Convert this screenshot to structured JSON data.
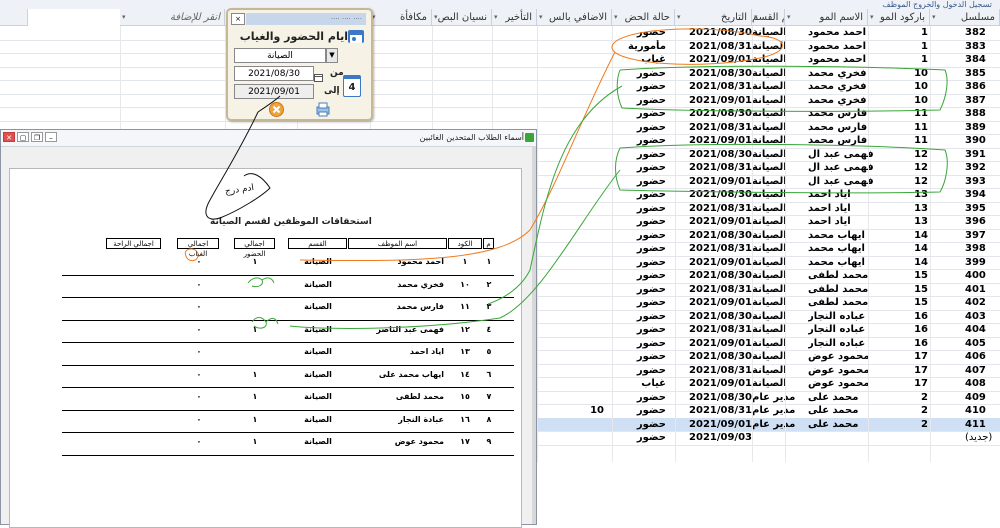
{
  "window_title": "تسجيل الدخول والخروج الموظف",
  "columns": [
    {
      "label": "مسلسل",
      "sort": true
    },
    {
      "label": "باركود المو",
      "sort": true
    },
    {
      "label": "الاسم المو",
      "sort": true
    },
    {
      "label": "اسم القسم",
      "sort": true
    },
    {
      "label": "التاريخ",
      "sort": true
    },
    {
      "label": "حالة الحض",
      "sort": true
    },
    {
      "label": "الاضافي بالس",
      "sort": true
    },
    {
      "label": "التأخير",
      "sort": true
    },
    {
      "label": "نسيان البص",
      "sort": true
    },
    {
      "label": "مكافأة",
      "sort": true
    },
    {
      "label": "وقت الدخ",
      "sort": true
    },
    {
      "label": "وقت الخرو",
      "sort": true
    },
    {
      "label": "انقر للإضافة",
      "sort": true
    }
  ],
  "rows": [
    {
      "id": "382",
      "code": "1",
      "name": "احمد محمود",
      "dept": "الصيانة",
      "date": "2021/08/30",
      "status": "حضور",
      "extra": ""
    },
    {
      "id": "383",
      "code": "1",
      "name": "احمد محمود",
      "dept": "الصيانة",
      "date": "2021/08/31",
      "status": "مأمورية",
      "extra": ""
    },
    {
      "id": "384",
      "code": "1",
      "name": "احمد محمود",
      "dept": "الصيانة",
      "date": "2021/09/01",
      "status": "غياب",
      "extra": ""
    },
    {
      "id": "385",
      "code": "10",
      "name": "فخري محمد",
      "dept": "الصيانة",
      "date": "2021/08/30",
      "status": "حضور",
      "extra": ""
    },
    {
      "id": "386",
      "code": "10",
      "name": "فخري محمد",
      "dept": "الصيانة",
      "date": "2021/08/31",
      "status": "حضور",
      "extra": ""
    },
    {
      "id": "387",
      "code": "10",
      "name": "فخري محمد",
      "dept": "الصيانة",
      "date": "2021/09/01",
      "status": "حضور",
      "extra": ""
    },
    {
      "id": "388",
      "code": "11",
      "name": "فارس محمد",
      "dept": "الصيانة",
      "date": "2021/08/30",
      "status": "حضور",
      "extra": ""
    },
    {
      "id": "389",
      "code": "11",
      "name": "فارس محمد",
      "dept": "الصيانة",
      "date": "2021/08/31",
      "status": "حضور",
      "extra": ""
    },
    {
      "id": "390",
      "code": "11",
      "name": "فارس محمد",
      "dept": "الصيانة",
      "date": "2021/09/01",
      "status": "حضور",
      "extra": ""
    },
    {
      "id": "391",
      "code": "12",
      "name": "فهمى عبد ال",
      "dept": "الصيانة",
      "date": "2021/08/30",
      "status": "حضور",
      "extra": ""
    },
    {
      "id": "392",
      "code": "12",
      "name": "فهمى عبد ال",
      "dept": "الصيانة",
      "date": "2021/08/31",
      "status": "حضور",
      "extra": ""
    },
    {
      "id": "393",
      "code": "12",
      "name": "فهمى عبد ال",
      "dept": "الصيانة",
      "date": "2021/09/01",
      "status": "حضور",
      "extra": ""
    },
    {
      "id": "394",
      "code": "13",
      "name": "اياد احمد",
      "dept": "الصيانة",
      "date": "2021/08/30",
      "status": "حضور",
      "extra": ""
    },
    {
      "id": "395",
      "code": "13",
      "name": "اياد احمد",
      "dept": "الصيانة",
      "date": "2021/08/31",
      "status": "حضور",
      "extra": ""
    },
    {
      "id": "396",
      "code": "13",
      "name": "اياد احمد",
      "dept": "الصيانة",
      "date": "2021/09/01",
      "status": "حضور",
      "extra": ""
    },
    {
      "id": "397",
      "code": "14",
      "name": "ايهاب محمد",
      "dept": "الصيانة",
      "date": "2021/08/30",
      "status": "حضور",
      "extra": ""
    },
    {
      "id": "398",
      "code": "14",
      "name": "ايهاب محمد",
      "dept": "الصيانة",
      "date": "2021/08/31",
      "status": "حضور",
      "extra": ""
    },
    {
      "id": "399",
      "code": "14",
      "name": "ايهاب محمد",
      "dept": "الصيانة",
      "date": "2021/09/01",
      "status": "حضور",
      "extra": ""
    },
    {
      "id": "400",
      "code": "15",
      "name": "محمد لطفى",
      "dept": "الصيانة",
      "date": "2021/08/30",
      "status": "حضور",
      "extra": ""
    },
    {
      "id": "401",
      "code": "15",
      "name": "محمد لطفى",
      "dept": "الصيانة",
      "date": "2021/08/31",
      "status": "حضور",
      "extra": ""
    },
    {
      "id": "402",
      "code": "15",
      "name": "محمد لطفى",
      "dept": "الصيانة",
      "date": "2021/09/01",
      "status": "حضور",
      "extra": ""
    },
    {
      "id": "403",
      "code": "16",
      "name": "عباده النجار",
      "dept": "الصيانة",
      "date": "2021/08/30",
      "status": "حضور",
      "extra": ""
    },
    {
      "id": "404",
      "code": "16",
      "name": "عباده النجار",
      "dept": "الصيانة",
      "date": "2021/08/31",
      "status": "حضور",
      "extra": ""
    },
    {
      "id": "405",
      "code": "16",
      "name": "عباده النجار",
      "dept": "الصيانة",
      "date": "2021/09/01",
      "status": "حضور",
      "extra": ""
    },
    {
      "id": "406",
      "code": "17",
      "name": "محمود عوض",
      "dept": "الصيانة",
      "date": "2021/08/30",
      "status": "حضور",
      "extra": ""
    },
    {
      "id": "407",
      "code": "17",
      "name": "محمود عوض",
      "dept": "الصيانة",
      "date": "2021/08/31",
      "status": "حضور",
      "extra": ""
    },
    {
      "id": "408",
      "code": "17",
      "name": "محمود عوض",
      "dept": "الصيانة",
      "date": "2021/09/01",
      "status": "غياب",
      "extra": ""
    },
    {
      "id": "409",
      "code": "2",
      "name": "محمد على",
      "dept": "مدير عام",
      "date": "2021/08/30",
      "status": "حضور",
      "extra": ""
    },
    {
      "id": "410",
      "code": "2",
      "name": "محمد على",
      "dept": "مدير عام",
      "date": "2021/08/31",
      "status": "حضور",
      "extra": "10"
    },
    {
      "id": "411",
      "code": "2",
      "name": "محمد على",
      "dept": "مدير عام",
      "date": "2021/09/01",
      "status": "حضور",
      "extra": ""
    },
    {
      "id": "(جديد)",
      "code": "",
      "name": "",
      "dept": "",
      "date": "2021/09/03",
      "status": "حضور",
      "extra": ""
    }
  ],
  "popup": {
    "title": "ايام الحضور والغياب",
    "department": "الصيانة",
    "from_label": "من",
    "to_label": "إلى",
    "from_date": "2021/08/30",
    "to_date": "2021/09/01",
    "calendar_day": "4"
  },
  "report": {
    "window_title": "أسماء الطلاب المتحدين الغائبين",
    "heading": "استحقاقات الموظفين لقسم الصيانة",
    "stamp_text": "ادم درج",
    "headers": {
      "num": "م",
      "code": "الكود",
      "name": "اسم الموظف",
      "dept": "القسم",
      "present": "اجمالي الحضور",
      "absent": "اجمالي الغياب",
      "rest": "اجمالي الراحة"
    },
    "rows": [
      {
        "num": "١",
        "code": "١",
        "name": "احمد محمود",
        "dept": "الصيانة",
        "present": "١",
        "absent": "٠",
        "rest": ""
      },
      {
        "num": "٢",
        "code": "١٠",
        "name": "فخري محمد",
        "dept": "الصيانة",
        "present": "",
        "absent": "",
        "rest": "٠"
      },
      {
        "num": "٣",
        "code": "١١",
        "name": "فارس محمد",
        "dept": "الصيانة",
        "present": "",
        "absent": "",
        "rest": "٠"
      },
      {
        "num": "٤",
        "code": "١٢",
        "name": "فهمى عبد الناصر",
        "dept": "الصيانة",
        "present": "١",
        "absent": "",
        "rest": "٠"
      },
      {
        "num": "٥",
        "code": "١٣",
        "name": "اياد احمد",
        "dept": "الصيانة",
        "present": "",
        "absent": "",
        "rest": "٠"
      },
      {
        "num": "٦",
        "code": "١٤",
        "name": "ايهاب محمد على",
        "dept": "الصيانة",
        "present": "١",
        "absent": "",
        "rest": "٠"
      },
      {
        "num": "٧",
        "code": "١٥",
        "name": "محمد لطفى",
        "dept": "الصيانة",
        "present": "١",
        "absent": "",
        "rest": "٠"
      },
      {
        "num": "٨",
        "code": "١٦",
        "name": "عبادة النجار",
        "dept": "الصيانة",
        "present": "١",
        "absent": "",
        "rest": "٠"
      },
      {
        "num": "٩",
        "code": "١٧",
        "name": "محمود عوض",
        "dept": "الصيانة",
        "present": "١",
        "absent": "",
        "rest": "٠"
      }
    ]
  },
  "colors": {
    "annotation_orange": "#f07a1e",
    "annotation_green": "#3aa63a",
    "selected_row": "#cfe0f5",
    "popup_bg": "#f6f3e6"
  }
}
